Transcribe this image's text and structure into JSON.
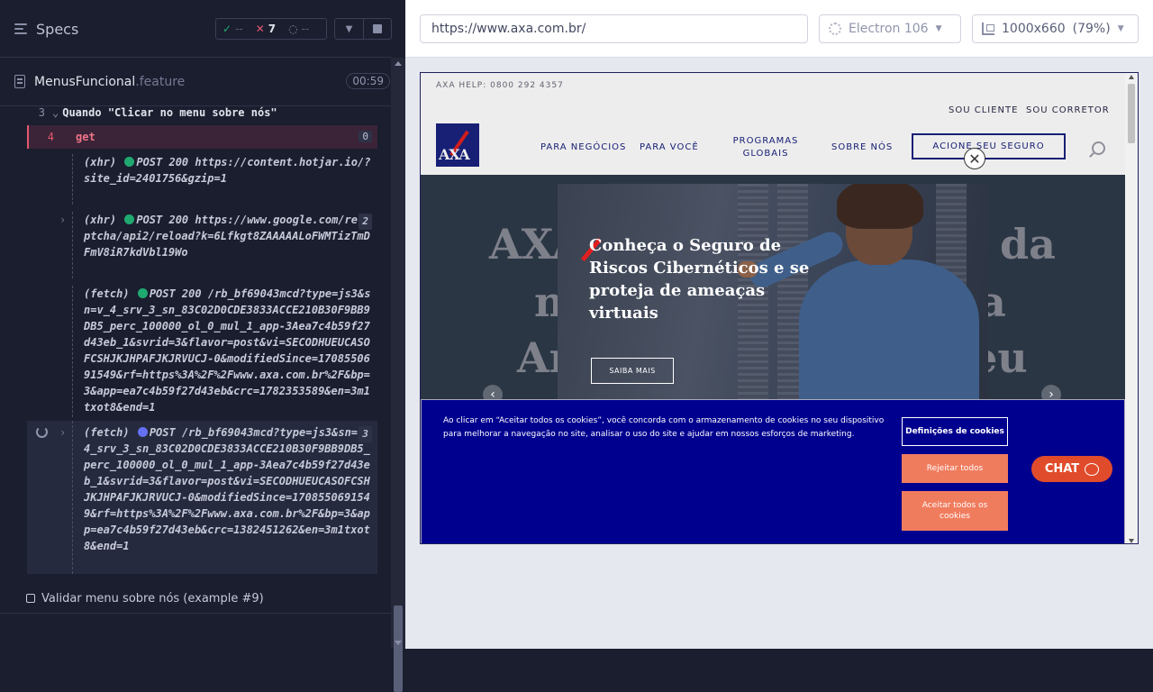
{
  "reporter": {
    "title": "Specs",
    "stats": {
      "passed": "--",
      "failed": "7",
      "pending": "--"
    },
    "spec": {
      "name": "MenusFuncional",
      "ext": ".feature",
      "duration": "00:59"
    },
    "step": {
      "number": "3",
      "keyword": "Quando",
      "text": " \"Clicar no menu sobre nós\""
    },
    "command": {
      "number": "4",
      "name": "get",
      "count": "0"
    },
    "logs": [
      {
        "type": "(xhr)",
        "status": "POST 200",
        "url": "https://content.hotjar.io/?site_id=2401756&gzip=1",
        "count": ""
      },
      {
        "type": "(xhr)",
        "status": "POST 200",
        "url": "https://www.google.com/recaptcha/api2/reload?k=6Lfkgt8ZAAAAALoFWMTizTmDFmV8iR7kdVbl19Wo",
        "count": "2"
      },
      {
        "type": "(fetch)",
        "status": "POST 200",
        "url": "/rb_bf69043mcd?type=js3&sn=v_4_srv_3_sn_83C02D0CDE3833ACCE210B30F9BB9DB5_perc_100000_ol_0_mul_1_app-3Aea7c4b59f27d43eb_1&svrid=3&flavor=post&vi=SECODHUEUCASOFCSHJKJHPAFJKJRVUCJ-0&modifiedSince=1708550691549&rf=https%3A%2F%2Fwww.axa.com.br%2F&bp=3&app=ea7c4b59f27d43eb&crc=1782353589&en=3m1txot8&end=1",
        "count": ""
      },
      {
        "type": "(fetch)",
        "status": "POST",
        "url": "/rb_bf69043mcd?type=js3&sn=v_4_srv_3_sn_83C02D0CDE3833ACCE210B30F9BB9DB5_perc_100000_ol_0_mul_1_app-3Aea7c4b59f27d43eb_1&svrid=3&flavor=post&vi=SECODHUEUCASOFCSHJKJHPAFJKJRVUCJ-0&modifiedSince=1708550691549&rf=https%3A%2F%2Fwww.axa.com.br%2F&bp=3&app=ea7c4b59f27d43eb&crc=1382451262&en=3m1txot8&end=1",
        "count": "3"
      }
    ],
    "next_test": "Validar menu sobre nós (example #9)"
  },
  "aut": {
    "url": "https://www.axa.com.br/",
    "browser": "Electron 106",
    "viewport": "1000x660",
    "zoom": "(79%)"
  },
  "site": {
    "help": "AXA HELP: 0800 292 4357",
    "top_links": [
      "SOU CLIENTE",
      "SOU CORRETOR"
    ],
    "logo_text": "AXA",
    "nav": [
      "PARA NEGÓCIOS",
      "PARA VOCÊ",
      "PROGRAMAS GLOBAIS",
      "SOBRE NÓS"
    ],
    "cta": "ACIONE SEU SEGURO",
    "hero_bg": [
      "AXA",
      "da",
      "n",
      "a",
      "Ar",
      "eu"
    ],
    "promo": {
      "title": "Conheça o Seguro de Riscos Cibernéticos e se proteja de ameaças virtuais",
      "button": "SAIBA MAIS"
    },
    "cookie": {
      "text": "Ao clicar em “Aceitar todos os cookies”, você concorda com o armazenamento de cookies no seu dispositivo para melhorar a navegação no site, analisar o uso do site e ajudar em nossos esforços de marketing.",
      "settings": "Definições de cookies",
      "reject": "Rejeitar todos",
      "accept": "Aceitar todos os cookies"
    },
    "chat": "CHAT"
  },
  "colors": {
    "reporter_bg": "#1b1e2e",
    "fail": "#e45770",
    "pass": "#1fa971",
    "axa_blue": "#00008f",
    "axa_orange": "#f07c5e"
  }
}
